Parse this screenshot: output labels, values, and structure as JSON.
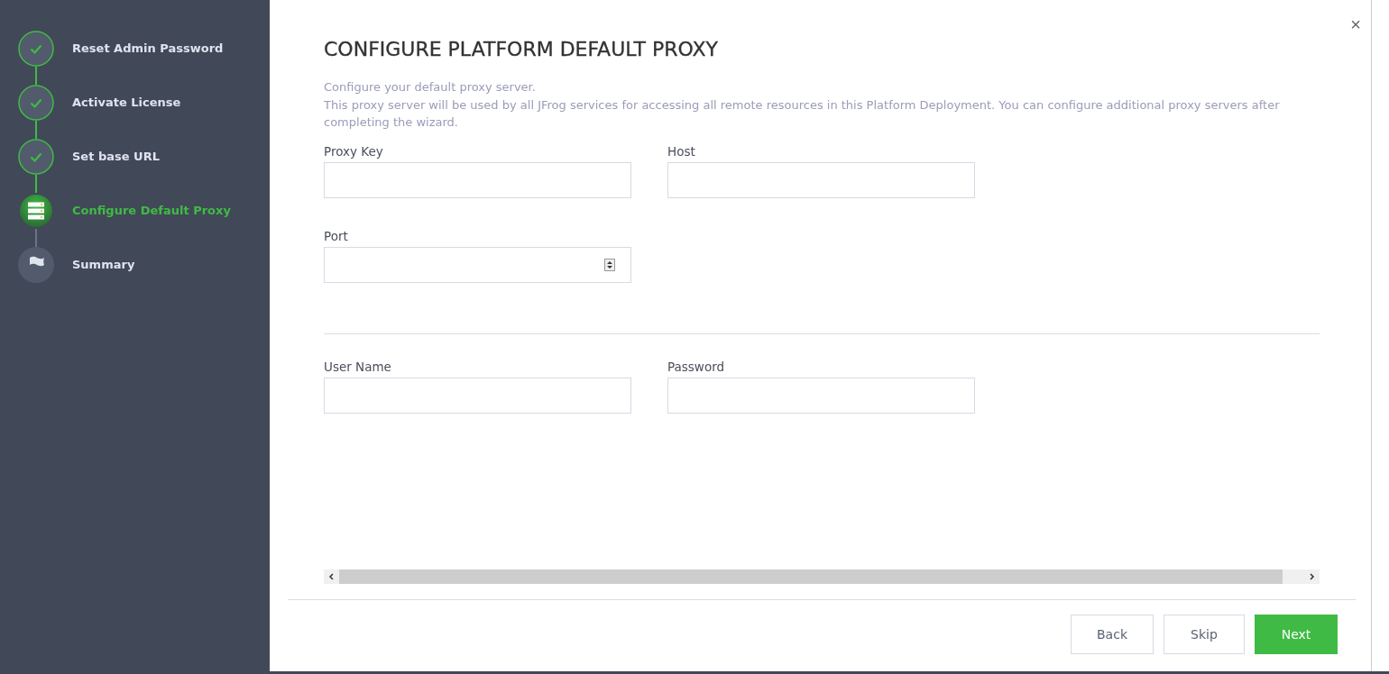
{
  "steps": [
    {
      "label": "Reset Admin Password",
      "kind": "done"
    },
    {
      "label": "Activate License",
      "kind": "done"
    },
    {
      "label": "Set base URL",
      "kind": "done"
    },
    {
      "label": "Configure Default Proxy",
      "kind": "current"
    },
    {
      "label": "Summary",
      "kind": "pending"
    }
  ],
  "close": "×",
  "title": "CONFIGURE PLATFORM DEFAULT PROXY",
  "description": [
    "Configure your default proxy server.",
    "This proxy server will be used by all JFrog services for accessing all remote resources in this Platform Deployment. You can configure additional proxy servers after completing the wizard."
  ],
  "field_groups": [
    [
      {
        "label": "Proxy Key",
        "kind": "text"
      },
      {
        "label": "Host",
        "kind": "text"
      },
      {
        "label": "Port",
        "kind": "number"
      }
    ],
    [
      {
        "label": "User Name",
        "kind": "text"
      },
      {
        "label": "Password",
        "kind": "password"
      }
    ]
  ],
  "buttons": [
    {
      "label": "Back",
      "kind": "secondary"
    },
    {
      "label": "Skip",
      "kind": "secondary"
    },
    {
      "label": "Next",
      "kind": "primary"
    }
  ]
}
